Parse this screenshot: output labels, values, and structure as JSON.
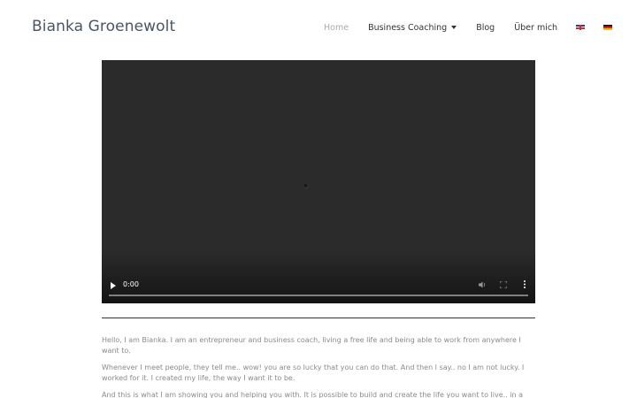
{
  "header": {
    "site_title": "Bianka Groenewolt",
    "nav": {
      "home": "Home",
      "business_coaching": "Business Coaching",
      "blog": "Blog",
      "about": "Über mich"
    },
    "languages": [
      "english-flag-icon",
      "german-flag-icon"
    ]
  },
  "video": {
    "time": "0:00",
    "progress": 0,
    "icons": [
      "play-icon",
      "mute-icon",
      "fullscreen-icon",
      "more-options-icon"
    ]
  },
  "content": {
    "paragraphs": [
      "Hello, I am Bianka. I am an entrepreneur and business coach, living a free life and being able to work from anywhere I want to.",
      "Whenever I meet people, they tell me.. wow! you are so lucky that you can do that. And then I say.. no I am not lucky. I worked for it. I created my life, the way I want it to be.",
      "And this is what I am showing you and helping you with. It is possible to build and create the life you want to live.. in a business context and also regarding your private life."
    ]
  },
  "colors": {
    "title": "#4a5565",
    "nav_active": "#aaaaaa",
    "video_bg": "#2b2b2b",
    "body_text": "#8a8a8a"
  }
}
